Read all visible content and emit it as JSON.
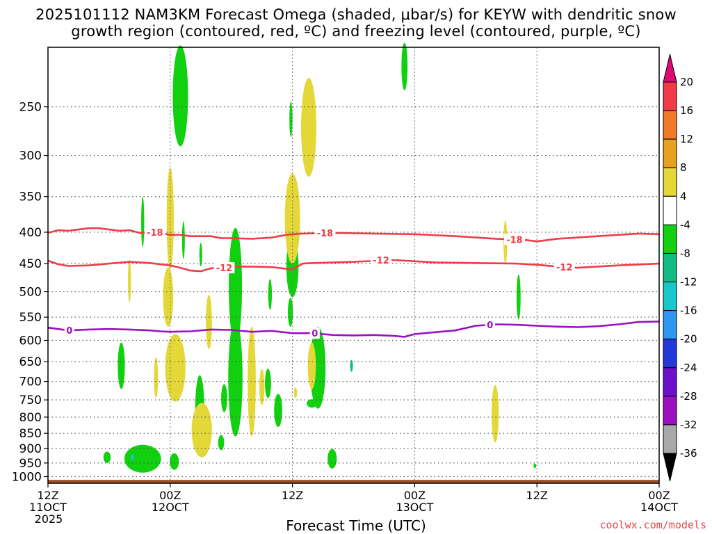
{
  "figure": {
    "title_line1": "2025101112 NAM3KM Forecast Omega (shaded, μbar/s) for KEYW with dendritic snow",
    "title_line2": "growth region (contoured, red, ºC) and freezing level (contoured, purple, ºC)",
    "credit": "coolwx.com/models"
  },
  "chart_data": {
    "type": "heatmap",
    "title": "2025101112 NAM3KM Forecast Omega (shaded, μbar/s) for KEYW with dendritic snow growth region (contoured, red, ºC) and freezing level (contoured, purple, ºC)",
    "xlabel": "Forecast Time (UTC)",
    "ylabel": "",
    "x_ticks": [
      {
        "hour": 0,
        "lines": [
          "12Z",
          "11OCT",
          "2025"
        ]
      },
      {
        "hour": 12,
        "lines": [
          "00Z",
          "12OCT"
        ]
      },
      {
        "hour": 24,
        "lines": [
          "12Z"
        ]
      },
      {
        "hour": 36,
        "lines": [
          "00Z",
          "13OCT"
        ]
      },
      {
        "hour": 48,
        "lines": [
          "12Z"
        ]
      },
      {
        "hour": 60,
        "lines": [
          "00Z",
          "14OCT"
        ]
      }
    ],
    "xlim_hours": [
      0,
      60
    ],
    "y_ticks": [
      250,
      300,
      350,
      400,
      450,
      500,
      550,
      600,
      650,
      700,
      750,
      800,
      850,
      900,
      950,
      1000
    ],
    "ylim_hPa": [
      1025,
      200
    ],
    "y_scale": "log-pressure",
    "grid": true,
    "colorbar": {
      "levels": [
        20,
        16,
        12,
        8,
        4,
        -4,
        -8,
        -12,
        -16,
        -20,
        -24,
        -28,
        -32,
        -36
      ],
      "colors": [
        "#dd0a75",
        "#f03c46",
        "#f07a28",
        "#e8a020",
        "#e4d838",
        "#ffffff",
        "#10d010",
        "#12bd84",
        "#18c8c8",
        "#2e98f0",
        "#2238d8",
        "#6a10c8",
        "#9a10c0",
        "#a8a8a8",
        "#000000"
      ]
    },
    "contours": [
      {
        "name": "-18",
        "color": "#f03c46",
        "points": [
          [
            0,
            401
          ],
          [
            1,
            397
          ],
          [
            2,
            398
          ],
          [
            3,
            396
          ],
          [
            4,
            394
          ],
          [
            5,
            394
          ],
          [
            6,
            396
          ],
          [
            7,
            398
          ],
          [
            8,
            397
          ],
          [
            9,
            401
          ],
          [
            10,
            402
          ],
          [
            11,
            401
          ],
          [
            12,
            404
          ],
          [
            13,
            404
          ],
          [
            14,
            406
          ],
          [
            16,
            406
          ],
          [
            17,
            409
          ],
          [
            18,
            409
          ],
          [
            20,
            410
          ],
          [
            22,
            408
          ],
          [
            23,
            405
          ],
          [
            24,
            403
          ],
          [
            25,
            402
          ],
          [
            28,
            401
          ],
          [
            32,
            402
          ],
          [
            36,
            403
          ],
          [
            40,
            406
          ],
          [
            44,
            410
          ],
          [
            47,
            412
          ],
          [
            48,
            414
          ],
          [
            50,
            410
          ],
          [
            52,
            408
          ],
          [
            55,
            405
          ],
          [
            58,
            402
          ],
          [
            60,
            403
          ]
        ],
        "labels": [
          [
            10.5,
            400
          ],
          [
            27.2,
            401
          ],
          [
            45.8,
            411
          ]
        ]
      },
      {
        "name": "-12",
        "color": "#f03c46",
        "points": [
          [
            0,
            445
          ],
          [
            1,
            451
          ],
          [
            2,
            454
          ],
          [
            4,
            453
          ],
          [
            6,
            450
          ],
          [
            8,
            447
          ],
          [
            10,
            449
          ],
          [
            12,
            453
          ],
          [
            13,
            457
          ],
          [
            14,
            462
          ],
          [
            15,
            463
          ],
          [
            16,
            458
          ],
          [
            18,
            455
          ],
          [
            20,
            455
          ],
          [
            22,
            456
          ],
          [
            24,
            460
          ],
          [
            25,
            450
          ],
          [
            26,
            449
          ],
          [
            30,
            447
          ],
          [
            34,
            444
          ],
          [
            38,
            448
          ],
          [
            42,
            449
          ],
          [
            46,
            450
          ],
          [
            48,
            452
          ],
          [
            50,
            455
          ],
          [
            52,
            457
          ],
          [
            56,
            453
          ],
          [
            60,
            450
          ]
        ],
        "labels": [
          [
            17.3,
            457
          ],
          [
            32.7,
            444
          ],
          [
            50.7,
            456
          ]
        ]
      },
      {
        "name": "0",
        "color": "#9a10c0",
        "points": [
          [
            0,
            572
          ],
          [
            2,
            578
          ],
          [
            4,
            576
          ],
          [
            6,
            575
          ],
          [
            8,
            576
          ],
          [
            10,
            578
          ],
          [
            11,
            580
          ],
          [
            12,
            581
          ],
          [
            14,
            580
          ],
          [
            16,
            576
          ],
          [
            18,
            577
          ],
          [
            20,
            581
          ],
          [
            22,
            579
          ],
          [
            24,
            584
          ],
          [
            26,
            584
          ],
          [
            27,
            586
          ],
          [
            28,
            588
          ],
          [
            30,
            589
          ],
          [
            32,
            588
          ],
          [
            34,
            590
          ],
          [
            35,
            592
          ],
          [
            36,
            586
          ],
          [
            38,
            582
          ],
          [
            40,
            578
          ],
          [
            42,
            568
          ],
          [
            44,
            565
          ],
          [
            46,
            566
          ],
          [
            48,
            568
          ],
          [
            50,
            570
          ],
          [
            52,
            571
          ],
          [
            54,
            569
          ],
          [
            56,
            565
          ],
          [
            58,
            560
          ],
          [
            60,
            559
          ]
        ],
        "labels": [
          [
            2.1,
            578
          ],
          [
            26.2,
            584
          ],
          [
            43.4,
            566
          ]
        ]
      }
    ],
    "surface_terrain_hPa": 1012,
    "shaded_regions": [
      {
        "level": "-8",
        "hour": 13.0,
        "p": 240,
        "dh": 0.75,
        "dp": 50
      },
      {
        "level": "-8",
        "hour": 35.0,
        "p": 215,
        "dh": 0.3,
        "dp": 20
      },
      {
        "level": "-8",
        "hour": 23.85,
        "p": 262,
        "dh": 0.15,
        "dp": 18
      },
      {
        "level": "-8",
        "hour": 9.3,
        "p": 385,
        "dh": 0.15,
        "dp": 38
      },
      {
        "level": "-8",
        "hour": 13.3,
        "p": 412,
        "dh": 0.12,
        "dp": 30
      },
      {
        "level": "-8",
        "hour": 15.0,
        "p": 435,
        "dh": 0.12,
        "dp": 20
      },
      {
        "level": "-8",
        "hour": 18.4,
        "p": 490,
        "dh": 0.65,
        "dp": 120
      },
      {
        "level": "-8",
        "hour": 18.4,
        "p": 690,
        "dh": 0.7,
        "dp": 170
      },
      {
        "level": "-8",
        "hour": 21.8,
        "p": 505,
        "dh": 0.18,
        "dp": 30
      },
      {
        "level": "-8",
        "hour": 24.0,
        "p": 455,
        "dh": 0.6,
        "dp": 55
      },
      {
        "level": "-8",
        "hour": 23.8,
        "p": 540,
        "dh": 0.25,
        "dp": 30
      },
      {
        "level": "-8",
        "hour": 7.2,
        "p": 660,
        "dh": 0.35,
        "dp": 60
      },
      {
        "level": "-8",
        "hour": 14.9,
        "p": 780,
        "dh": 0.45,
        "dp": 110
      },
      {
        "level": "-8",
        "hour": 17.3,
        "p": 745,
        "dh": 0.3,
        "dp": 40
      },
      {
        "level": "-8",
        "hour": 17.0,
        "p": 880,
        "dh": 0.3,
        "dp": 25
      },
      {
        "level": "-8",
        "hour": 21.6,
        "p": 705,
        "dh": 0.3,
        "dp": 40
      },
      {
        "level": "-8",
        "hour": 22.6,
        "p": 780,
        "dh": 0.4,
        "dp": 50
      },
      {
        "level": "-8",
        "hour": 26.5,
        "p": 665,
        "dh": 0.75,
        "dp": 110
      },
      {
        "level": "-8",
        "hour": 25.9,
        "p": 760,
        "dh": 0.5,
        "dp": 12
      },
      {
        "level": "-8",
        "hour": 27.9,
        "p": 935,
        "dh": 0.45,
        "dp": 35
      },
      {
        "level": "-8",
        "hour": 46.2,
        "p": 510,
        "dh": 0.2,
        "dp": 45
      },
      {
        "level": "-8",
        "hour": 5.8,
        "p": 930,
        "dh": 0.35,
        "dp": 20
      },
      {
        "level": "-8",
        "hour": 9.3,
        "p": 935,
        "dh": 1.8,
        "dp": 50
      },
      {
        "level": "-8",
        "hour": 12.4,
        "p": 945,
        "dh": 0.45,
        "dp": 30
      },
      {
        "level": "-8",
        "hour": 47.8,
        "p": 960,
        "dh": 0.12,
        "dp": 8
      },
      {
        "level": "-12",
        "hour": 29.8,
        "p": 660,
        "dh": 0.12,
        "dp": 15
      },
      {
        "level": "-16",
        "hour": 8.3,
        "p": 930,
        "dh": 0.12,
        "dp": 12
      },
      {
        "level": "4",
        "hour": 25.6,
        "p": 270,
        "dh": 0.75,
        "dp": 55
      },
      {
        "level": "4",
        "hour": 24.0,
        "p": 380,
        "dh": 0.75,
        "dp": 70
      },
      {
        "level": "4",
        "hour": 12.0,
        "p": 380,
        "dh": 0.35,
        "dp": 80
      },
      {
        "level": "4",
        "hour": 11.8,
        "p": 510,
        "dh": 0.5,
        "dp": 60
      },
      {
        "level": "4",
        "hour": 8.0,
        "p": 480,
        "dh": 0.15,
        "dp": 40
      },
      {
        "level": "4",
        "hour": 15.8,
        "p": 560,
        "dh": 0.3,
        "dp": 60
      },
      {
        "level": "4",
        "hour": 12.5,
        "p": 665,
        "dh": 1.0,
        "dp": 90
      },
      {
        "level": "4",
        "hour": 15.1,
        "p": 840,
        "dh": 1.0,
        "dp": 90
      },
      {
        "level": "4",
        "hour": 20.0,
        "p": 700,
        "dh": 0.4,
        "dp": 160
      },
      {
        "level": "4",
        "hour": 21.0,
        "p": 715,
        "dh": 0.25,
        "dp": 50
      },
      {
        "level": "4",
        "hour": 25.9,
        "p": 660,
        "dh": 0.4,
        "dp": 60
      },
      {
        "level": "4",
        "hour": 24.3,
        "p": 730,
        "dh": 0.15,
        "dp": 15
      },
      {
        "level": "4",
        "hour": 10.6,
        "p": 690,
        "dh": 0.2,
        "dp": 55
      },
      {
        "level": "4",
        "hour": 43.9,
        "p": 790,
        "dh": 0.35,
        "dp": 90
      },
      {
        "level": "4",
        "hour": 44.9,
        "p": 415,
        "dh": 0.18,
        "dp": 35
      }
    ]
  }
}
